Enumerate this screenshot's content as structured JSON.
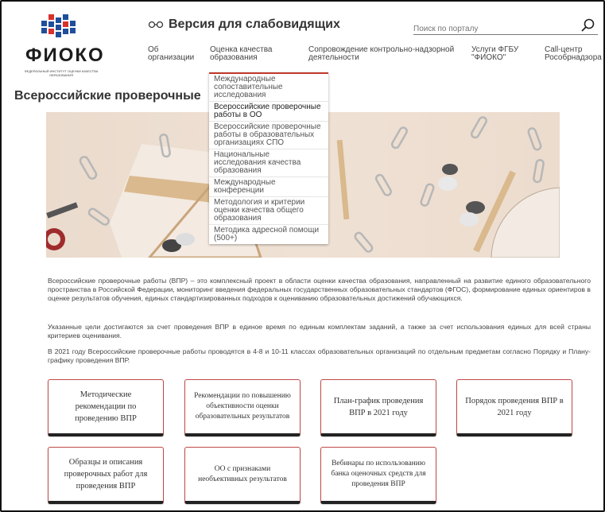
{
  "header": {
    "logo_text": "ФИОКО",
    "logo_subtitle": "Федеральный институт оценки качества образования",
    "vision_label": "Версия для слабовидящих",
    "search_placeholder": "Поиск по порталу"
  },
  "nav": [
    {
      "label": "Об\nорганизации"
    },
    {
      "label": "Оценка качества\nобразования"
    },
    {
      "label": "Сопровождение контрольно-надзорной\nдеятельности"
    },
    {
      "label": "Услуги ФГБУ\n\"ФИОКО\""
    },
    {
      "label": "Call-центр\nРособрнадзора"
    }
  ],
  "dropdown": [
    {
      "label": "Международные сопоставительные исследования"
    },
    {
      "label": "Всероссийские проверочные работы в ОО"
    },
    {
      "label": "Всероссийские проверочные работы в образовательных организациях СПО"
    },
    {
      "label": "Национальные исследования качества образования"
    },
    {
      "label": "Международные конференции"
    },
    {
      "label": "Методология и критерии оценки качества общего образования"
    },
    {
      "label": "Методика адресной помощи (500+)"
    }
  ],
  "page_title": "Всероссийские проверочные",
  "paragraphs": [
    "Всероссийские проверочные работы (ВПР) – это комплексный проект в области оценки качества образования, направленный на развитие единого образовательного пространства в Российской Федерации, мониторинг введения федеральных государственных образовательных стандартов (ФГОС), формирование единых ориентиров в оценке результатов обучения, единых стандартизированных подходов к оцениванию образовательных достижений обучающихся.",
    "Указанные цели достигаются за счет проведения ВПР в единое время по единым комплектам заданий, а также за счет использования единых для всей страны критериев оценивания.",
    "В 2021 году Всероссийские проверочные работы проводятся в 4-8 и 10-11 классах образовательных организаций по отдельным предметам согласно Порядку и Плану-графику проведения ВПР."
  ],
  "cards": [
    {
      "label": "Методические рекомендации по проведению ВПР"
    },
    {
      "label": "Рекомендации по повышению объективности оценки образовательных результатов"
    },
    {
      "label": "План-график проведения ВПР в 2021 году"
    },
    {
      "label": "Порядок проведения ВПР в 2021 году"
    },
    {
      "label": "Образцы и описания проверочных работ для проведения ВПР"
    },
    {
      "label": "ОО с признаками необъективных результатов"
    },
    {
      "label": "Вебинары по использованию банка оценочных средств для проведения ВПР"
    }
  ],
  "colors": {
    "accent": "#c0392b",
    "logo_blue": "#1f4e9c",
    "logo_red": "#d9302c"
  }
}
